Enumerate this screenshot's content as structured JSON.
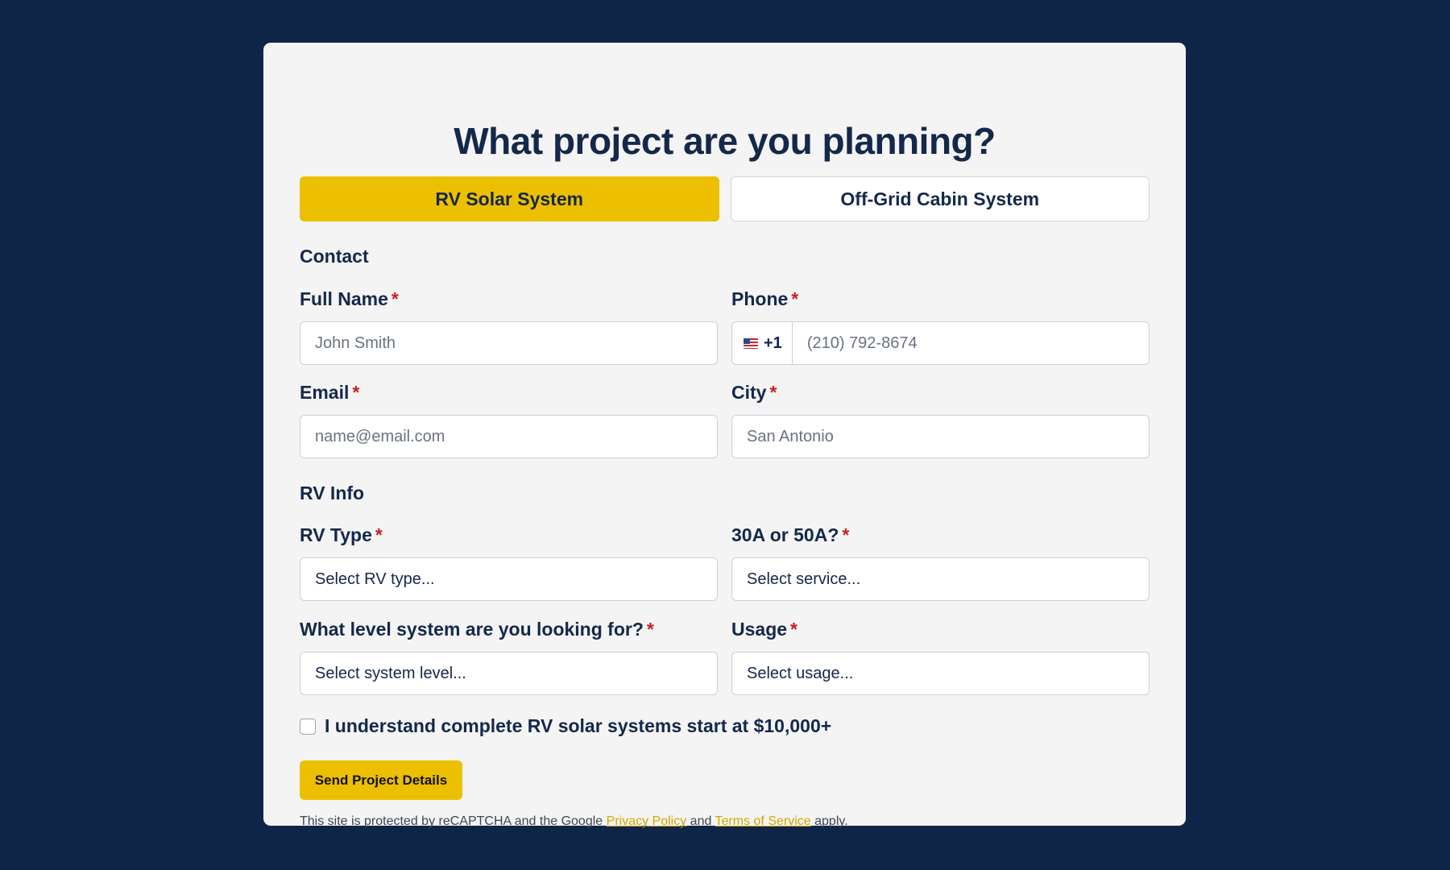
{
  "title": "What project are you planning?",
  "tabs": [
    {
      "label": "RV Solar System",
      "active": true
    },
    {
      "label": "Off-Grid Cabin System",
      "active": false
    }
  ],
  "contact": {
    "heading": "Contact",
    "full_name": {
      "label": "Full Name",
      "required": "*",
      "placeholder": "John Smith"
    },
    "phone": {
      "label": "Phone",
      "required": "*",
      "country_code": "+1",
      "placeholder": "(210) 792-8674"
    },
    "email": {
      "label": "Email",
      "required": "*",
      "placeholder": "name@email.com"
    },
    "city": {
      "label": "City",
      "required": "*",
      "placeholder": "San Antonio"
    }
  },
  "rv_info": {
    "heading": "RV Info",
    "rv_type": {
      "label": "RV Type",
      "required": "*",
      "value": "Select RV type..."
    },
    "service": {
      "label": "30A or 50A?",
      "required": "*",
      "value": "Select service..."
    },
    "system_level": {
      "label": "What level system are you looking for?",
      "required": "*",
      "value": "Select system level..."
    },
    "usage": {
      "label": "Usage",
      "required": "*",
      "value": "Select usage..."
    }
  },
  "acknowledge": {
    "label": "I understand complete RV solar systems start at $10,000+",
    "checked": false
  },
  "submit_label": "Send Project Details",
  "recaptcha": {
    "prefix": "This site is protected by reCAPTCHA and the Google",
    "privacy": "Privacy Policy",
    "and": "and",
    "terms": "Terms of Service",
    "suffix": "apply."
  },
  "colors": {
    "background": "#0f2548",
    "card": "#f4f4f4",
    "accent": "#ecbf00",
    "text": "#14284b",
    "required": "#c81f1f"
  }
}
